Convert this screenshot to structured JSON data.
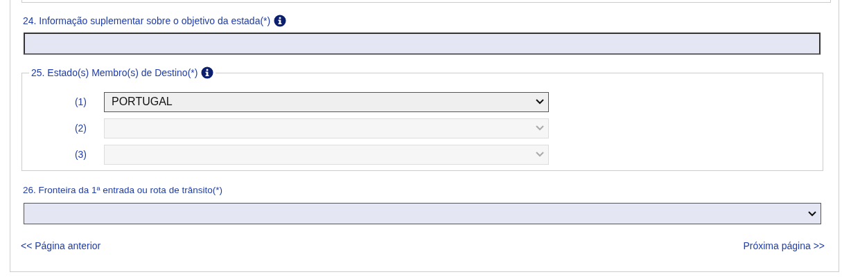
{
  "field_24": {
    "label": "24. Informação suplementar sobre o objetivo da estada(*)",
    "info": true
  },
  "field_25": {
    "legend": "25. Estado(s) Membro(s) de Destino(*)",
    "info": true,
    "rows": [
      {
        "index": "(1)",
        "value": "PORTUGAL",
        "disabled": false
      },
      {
        "index": "(2)",
        "disabled": true
      },
      {
        "index": "(3)",
        "disabled": true
      }
    ]
  },
  "field_26": {
    "label": "26. Fronteira da 1ª entrada ou rota de trânsito(*)"
  },
  "nav": {
    "previous": "<< Página anterior",
    "next": "Próxima página >>"
  }
}
